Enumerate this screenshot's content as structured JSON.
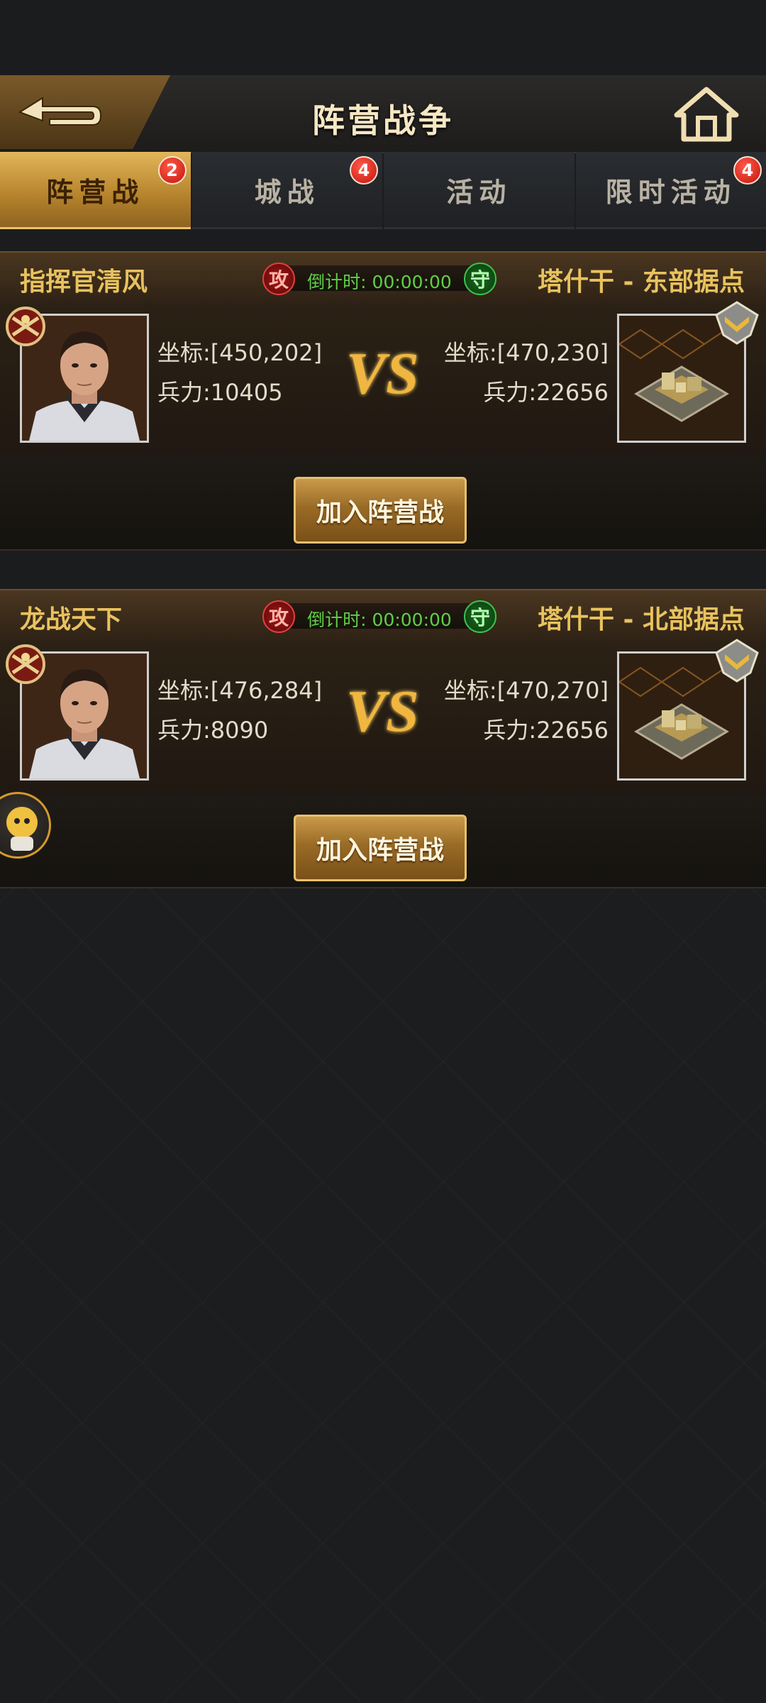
{
  "header": {
    "title": "阵营战争"
  },
  "tabs": [
    {
      "label": "阵营战",
      "badge": "2",
      "active": true
    },
    {
      "label": "城战",
      "badge": "4",
      "active": false
    },
    {
      "label": "活动",
      "badge": "",
      "active": false
    },
    {
      "label": "限时活动",
      "badge": "4",
      "active": false
    }
  ],
  "battles": [
    {
      "attacker_name": "指挥官清风",
      "attack_icon": "攻",
      "countdown": "倒计时: 00:00:00",
      "defend_icon": "守",
      "defender_name": "塔什干 - 东部据点",
      "attacker_coord": "坐标:[450,202]",
      "attacker_troops": "兵力:10405",
      "vs": "VS",
      "defender_coord": "坐标:[470,230]",
      "defender_troops": "兵力:22656",
      "join_label": "加入阵营战"
    },
    {
      "attacker_name": "龙战天下",
      "attack_icon": "攻",
      "countdown": "倒计时: 00:00:00",
      "defend_icon": "守",
      "defender_name": "塔什干 - 北部据点",
      "attacker_coord": "坐标:[476,284]",
      "attacker_troops": "兵力:8090",
      "vs": "VS",
      "defender_coord": "坐标:[470,270]",
      "defender_troops": "兵力:22656",
      "join_label": "加入阵营战"
    }
  ],
  "colors": {
    "gold": "#e8c25e",
    "timer": "#5fcf46",
    "badge": "#c4140b"
  }
}
